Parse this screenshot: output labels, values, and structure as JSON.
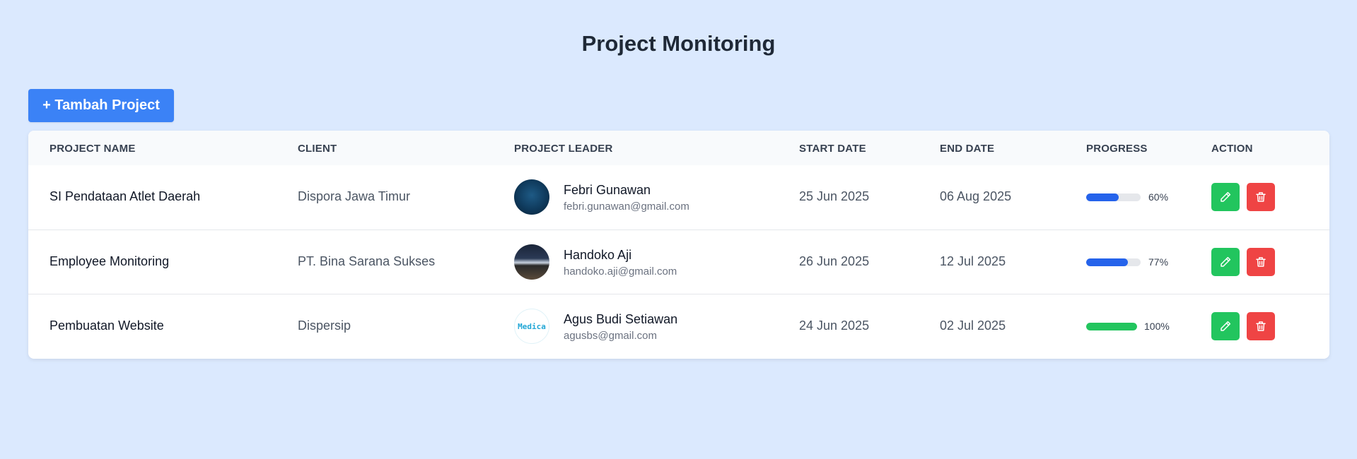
{
  "page": {
    "title": "Project Monitoring"
  },
  "toolbar": {
    "add_label": "+ Tambah Project"
  },
  "table": {
    "headers": {
      "project_name": "PROJECT NAME",
      "client": "CLIENT",
      "project_leader": "PROJECT LEADER",
      "start_date": "START DATE",
      "end_date": "END DATE",
      "progress": "PROGRESS",
      "action": "ACTION"
    },
    "rows": [
      {
        "project_name": "SI Pendataan Atlet Daerah",
        "client": "Dispora Jawa Timur",
        "leader_name": "Febri Gunawan",
        "leader_email": "febri.gunawan@gmail.com",
        "avatar": "dark-blue-photo",
        "start_date": "25 Jun 2025",
        "end_date": "06 Aug 2025",
        "progress": 0.6,
        "progress_label": "60%",
        "progress_color": "#2563eb"
      },
      {
        "project_name": "Employee Monitoring",
        "client": "PT. Bina Sarana Sukses",
        "leader_name": "Handoko Aji",
        "leader_email": "handoko.aji@gmail.com",
        "avatar": "night-landscape-photo",
        "start_date": "26 Jun 2025",
        "end_date": "12 Jul 2025",
        "progress": 0.77,
        "progress_label": "77%",
        "progress_color": "#2563eb"
      },
      {
        "project_name": "Pembuatan Website",
        "client": "Dispersip",
        "leader_name": "Agus Budi Setiawan",
        "leader_email": "agusbs@gmail.com",
        "avatar_text": "Medica",
        "start_date": "24 Jun 2025",
        "end_date": "02 Jul 2025",
        "progress": 1.0,
        "progress_label": "100%",
        "progress_color": "#22c55e"
      }
    ]
  },
  "icons": {
    "edit": "pencil-icon",
    "delete": "trash-icon"
  },
  "colors": {
    "background": "#dbe9fe",
    "primary": "#3b82f6",
    "success": "#22c55e",
    "danger": "#ef4444"
  }
}
